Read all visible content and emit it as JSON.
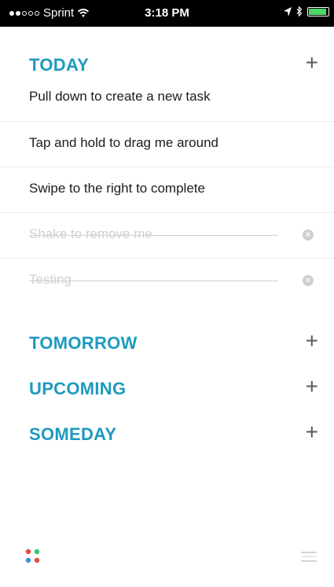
{
  "status_bar": {
    "carrier": "Sprint",
    "time": "3:18 PM",
    "signal_strength": "2 of 5",
    "icons": [
      "wifi-icon",
      "location-arrow-icon",
      "bluetooth-icon",
      "battery-icon"
    ],
    "battery_color": "#4cd964"
  },
  "sections": {
    "today": {
      "title": "TODAY",
      "add_label": "+"
    },
    "tomorrow": {
      "title": "TOMORROW",
      "add_label": "+"
    },
    "upcoming": {
      "title": "UPCOMING",
      "add_label": "+"
    },
    "someday": {
      "title": "SOMEDAY",
      "add_label": "+"
    }
  },
  "tasks": [
    {
      "text": "Pull down to create a new task",
      "completed": false
    },
    {
      "text": "Tap and hold to drag me around",
      "completed": false
    },
    {
      "text": "Swipe to the right to complete",
      "completed": false
    },
    {
      "text": "Shake to remove me",
      "completed": true
    },
    {
      "text": "Testing",
      "completed": true
    }
  ],
  "colors": {
    "accent": "#1d9ac0",
    "completed_text": "#d0d0d0",
    "logo_dots": [
      "#e84c3d",
      "#2ecc71",
      "#3498db",
      "#e84c3d"
    ]
  },
  "icons": {
    "delete": "x-circle-icon",
    "logo": "app-logo-icon",
    "menu": "menu-icon"
  }
}
